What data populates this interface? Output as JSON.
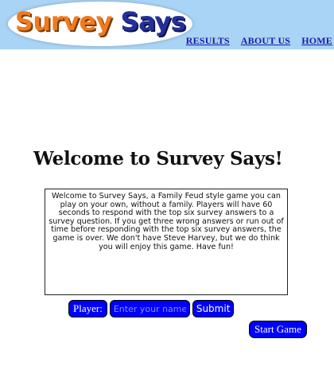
{
  "header": {
    "logo": {
      "word1": "Survey",
      "word2": "Says"
    },
    "nav": [
      "RESULTS",
      "ABOUT US",
      "HOME"
    ]
  },
  "main": {
    "title": "Welcome to Survey Says!",
    "intro": "Welcome to Survey Says, a Family Feud style game you can play on your own, without a family. Players will have 60 seconds to respond with the top six survey answers to a survey question. If you get three wrong answers or run out of time before responding with the top six survey answers, the game is over. We don't have Steve Harvey, but we do think you will enjoy this game. Have fun!",
    "player_label": "Player:",
    "player_placeholder": "Enter your name here",
    "player_value": "",
    "submit_label": "Submit",
    "start_label": "Start Game"
  },
  "colors": {
    "header_bg": "#a9d4f5",
    "logo_word1": "#f07a1c",
    "logo_word2": "#23309a",
    "nav_link": "#1a1aa8",
    "button_bg": "#0000ff"
  }
}
